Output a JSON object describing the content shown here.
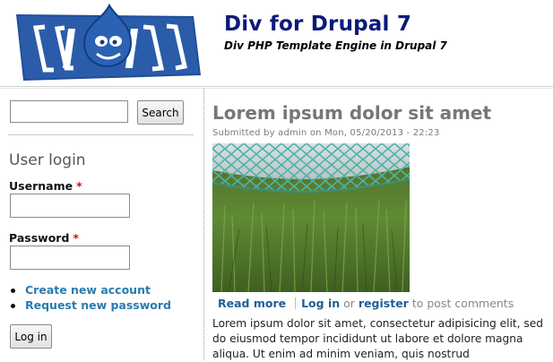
{
  "header": {
    "site_name": "Div for Drupal 7",
    "slogan": "Div PHP Template Engine in Drupal 7",
    "logo_icon": "drupal-div-logo"
  },
  "search": {
    "value": "",
    "button_label": "Search"
  },
  "user_login": {
    "title": "User login",
    "username_label": "Username",
    "password_label": "Password",
    "required_mark": "*",
    "username_value": "",
    "password_value": "",
    "links": [
      "Create new account",
      "Request new password"
    ],
    "submit_label": "Log in"
  },
  "article": {
    "title": "Lorem ipsum dolor sit amet",
    "submitted": "Submitted by admin on Mon, 05/20/2013 - 22:23",
    "image_icon": "fence-grass-photo",
    "read_more": "Read more",
    "login_link": "Log in",
    "or_text": "or",
    "register_link": "register",
    "post_comments_text": "to post comments",
    "body": "Lorem ipsum dolor sit amet, consectetur adipisicing elit, sed do eiusmod tempor incididunt ut labore et dolore magna aliqua. Ut enim ad minim veniam, quis nostrud"
  },
  "colors": {
    "site_name": "#0b1a7a",
    "link": "#2a7ab0",
    "required": "#cc1111",
    "title_gray": "#777777"
  }
}
